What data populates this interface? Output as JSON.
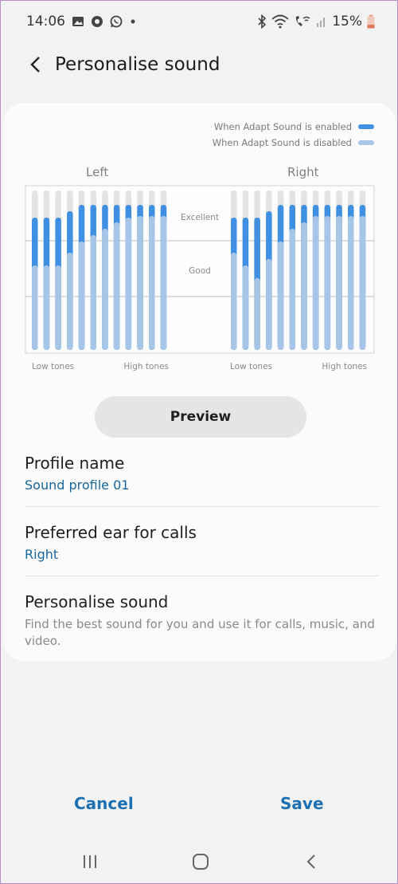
{
  "status_bar": {
    "time": "14:06",
    "battery": "15%",
    "left_icons": [
      "gallery-icon",
      "record-icon",
      "whatsapp-icon",
      "dot-icon"
    ],
    "right_icons": [
      "bluetooth-icon",
      "wifi-icon",
      "wifi-calling-icon",
      "signal-icon",
      "battery-icon"
    ]
  },
  "header": {
    "title": "Personalise sound",
    "back_icon": "back-arrow-icon"
  },
  "legend": {
    "enabled_label": "When Adapt Sound is enabled",
    "disabled_label": "When Adapt Sound is disabled",
    "enabled_color": "#3f8fe2",
    "disabled_color": "#a7c6e7"
  },
  "chart_data": {
    "type": "bar",
    "levels": {
      "excellent": "Excellent",
      "good": "Good"
    },
    "left": {
      "title": "Left",
      "low_label": "Low tones",
      "high_label": "High tones",
      "enabled": [
        0.83,
        0.83,
        0.83,
        0.87,
        0.91,
        0.91,
        0.91,
        0.91,
        0.91,
        0.91,
        0.91,
        0.91
      ],
      "disabled": [
        0.53,
        0.53,
        0.53,
        0.61,
        0.68,
        0.72,
        0.76,
        0.8,
        0.83,
        0.84,
        0.84,
        0.84
      ]
    },
    "right": {
      "title": "Right",
      "low_label": "Low tones",
      "high_label": "High tones",
      "enabled": [
        0.83,
        0.83,
        0.83,
        0.87,
        0.91,
        0.91,
        0.91,
        0.91,
        0.91,
        0.91,
        0.91,
        0.91
      ],
      "disabled": [
        0.61,
        0.53,
        0.45,
        0.57,
        0.68,
        0.76,
        0.8,
        0.84,
        0.84,
        0.84,
        0.84,
        0.84
      ]
    },
    "colors": {
      "track": "#e3e3e3",
      "enabled": "#3f8fe2",
      "disabled": "#a7c6e7"
    }
  },
  "preview_button": "Preview",
  "settings": {
    "profile": {
      "title": "Profile name",
      "value": "Sound profile 01"
    },
    "ear": {
      "title": "Preferred ear for calls",
      "value": "Right"
    },
    "personalise": {
      "title": "Personalise sound",
      "desc": "Find the best sound for you and use it for calls, music, and video."
    }
  },
  "actions": {
    "cancel": "Cancel",
    "save": "Save"
  },
  "nav": {
    "recents": "recents-icon",
    "home": "home-icon",
    "back": "back-icon"
  }
}
